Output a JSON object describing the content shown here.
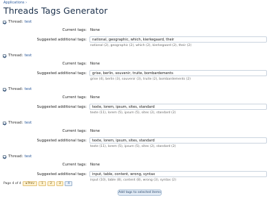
{
  "breadcrumb": "Applications ›",
  "page_title": "Threads Tags Generator",
  "labels": {
    "thread": "Thread:",
    "current_tags": "Current tags:",
    "suggested": "Suggested additional tags:"
  },
  "threads": [
    {
      "link": "test",
      "current_tags": "None",
      "suggested_value": "national, geographic, which, kierkegaard, their",
      "hint": "national (2), geographic (2), which (2), kierkegaard (2), their (2)"
    },
    {
      "link": "test",
      "current_tags": "None",
      "suggested_value": "grise, berlin, souvenir, truite, bombardements",
      "hint": "grise (4), berlin (3), souvenir (3), truite (2), bombardements (2)"
    },
    {
      "link": "test",
      "current_tags": "None",
      "suggested_value": "texte, lorem, ipsum, sites, standard",
      "hint": "texte (11), lorem (5), ipsum (5), sites (2), standard (2)"
    },
    {
      "link": "test",
      "current_tags": "None",
      "suggested_value": "texte, lorem, ipsum, sites, standard",
      "hint": "texte (11), lorem (5), ipsum (5), sites (2), standard (2)"
    },
    {
      "link": "test",
      "current_tags": "None",
      "suggested_value": "input, table, content, wrong, syntax",
      "hint": "input (10), table (8), content (8), wrong (3), syntax (2)"
    }
  ],
  "pager": {
    "label": "Page 4 of 4",
    "prev": "◂ Prev",
    "pages": [
      "1",
      "2",
      "3",
      "4"
    ],
    "current": "4"
  },
  "submit_label": "Add tags to selected items"
}
